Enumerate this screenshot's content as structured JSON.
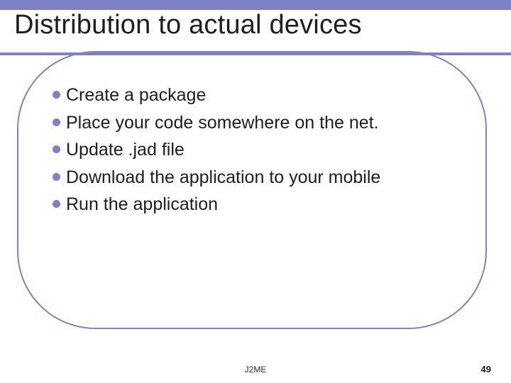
{
  "title": "Distribution to actual devices",
  "bullets": [
    "Create a package",
    "Place your code somewhere on the net.",
    "Update .jad file",
    "Download the application to your mobile",
    "Run the application"
  ],
  "footer": {
    "center": "J2ME",
    "page_number": "49"
  },
  "colors": {
    "accent": "#7c82c4"
  }
}
